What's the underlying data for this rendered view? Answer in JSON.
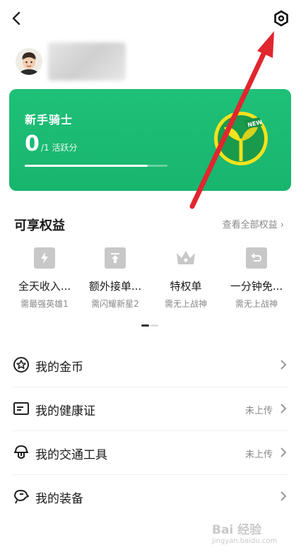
{
  "header": {
    "back_icon": "chevron-left-icon",
    "settings_icon": "hexagon-settings-icon"
  },
  "card": {
    "title": "新手骑士",
    "score": "0",
    "unit": "/1 活跃分",
    "progress": 0.86,
    "badge_text": "NEW",
    "bg_color": "#1cbb72"
  },
  "benefits": {
    "title": "可享权益",
    "view_all": "查看全部权益",
    "items": [
      {
        "name": "全天收入...",
        "req": "需最强英雄1",
        "icon": "lightning-icon"
      },
      {
        "name": "额外接单...",
        "req": "需闪耀新星2",
        "icon": "upload-icon"
      },
      {
        "name": "特权单",
        "req": "需无上战神",
        "icon": "crown-icon"
      },
      {
        "name": "一分钟免...",
        "req": "需无上战神",
        "icon": "undo-icon"
      }
    ]
  },
  "menu": [
    {
      "label": "我的金币",
      "status": "",
      "icon": "star-coin-icon"
    },
    {
      "label": "我的健康证",
      "status": "未上传",
      "icon": "id-card-icon"
    },
    {
      "label": "我的交通工具",
      "status": "未上传",
      "icon": "helmet-icon"
    },
    {
      "label": "我的装备",
      "status": "",
      "icon": "equipment-icon"
    }
  ],
  "watermark": {
    "text": "Bai 经验",
    "sub": "jingyan.baidu.com"
  }
}
